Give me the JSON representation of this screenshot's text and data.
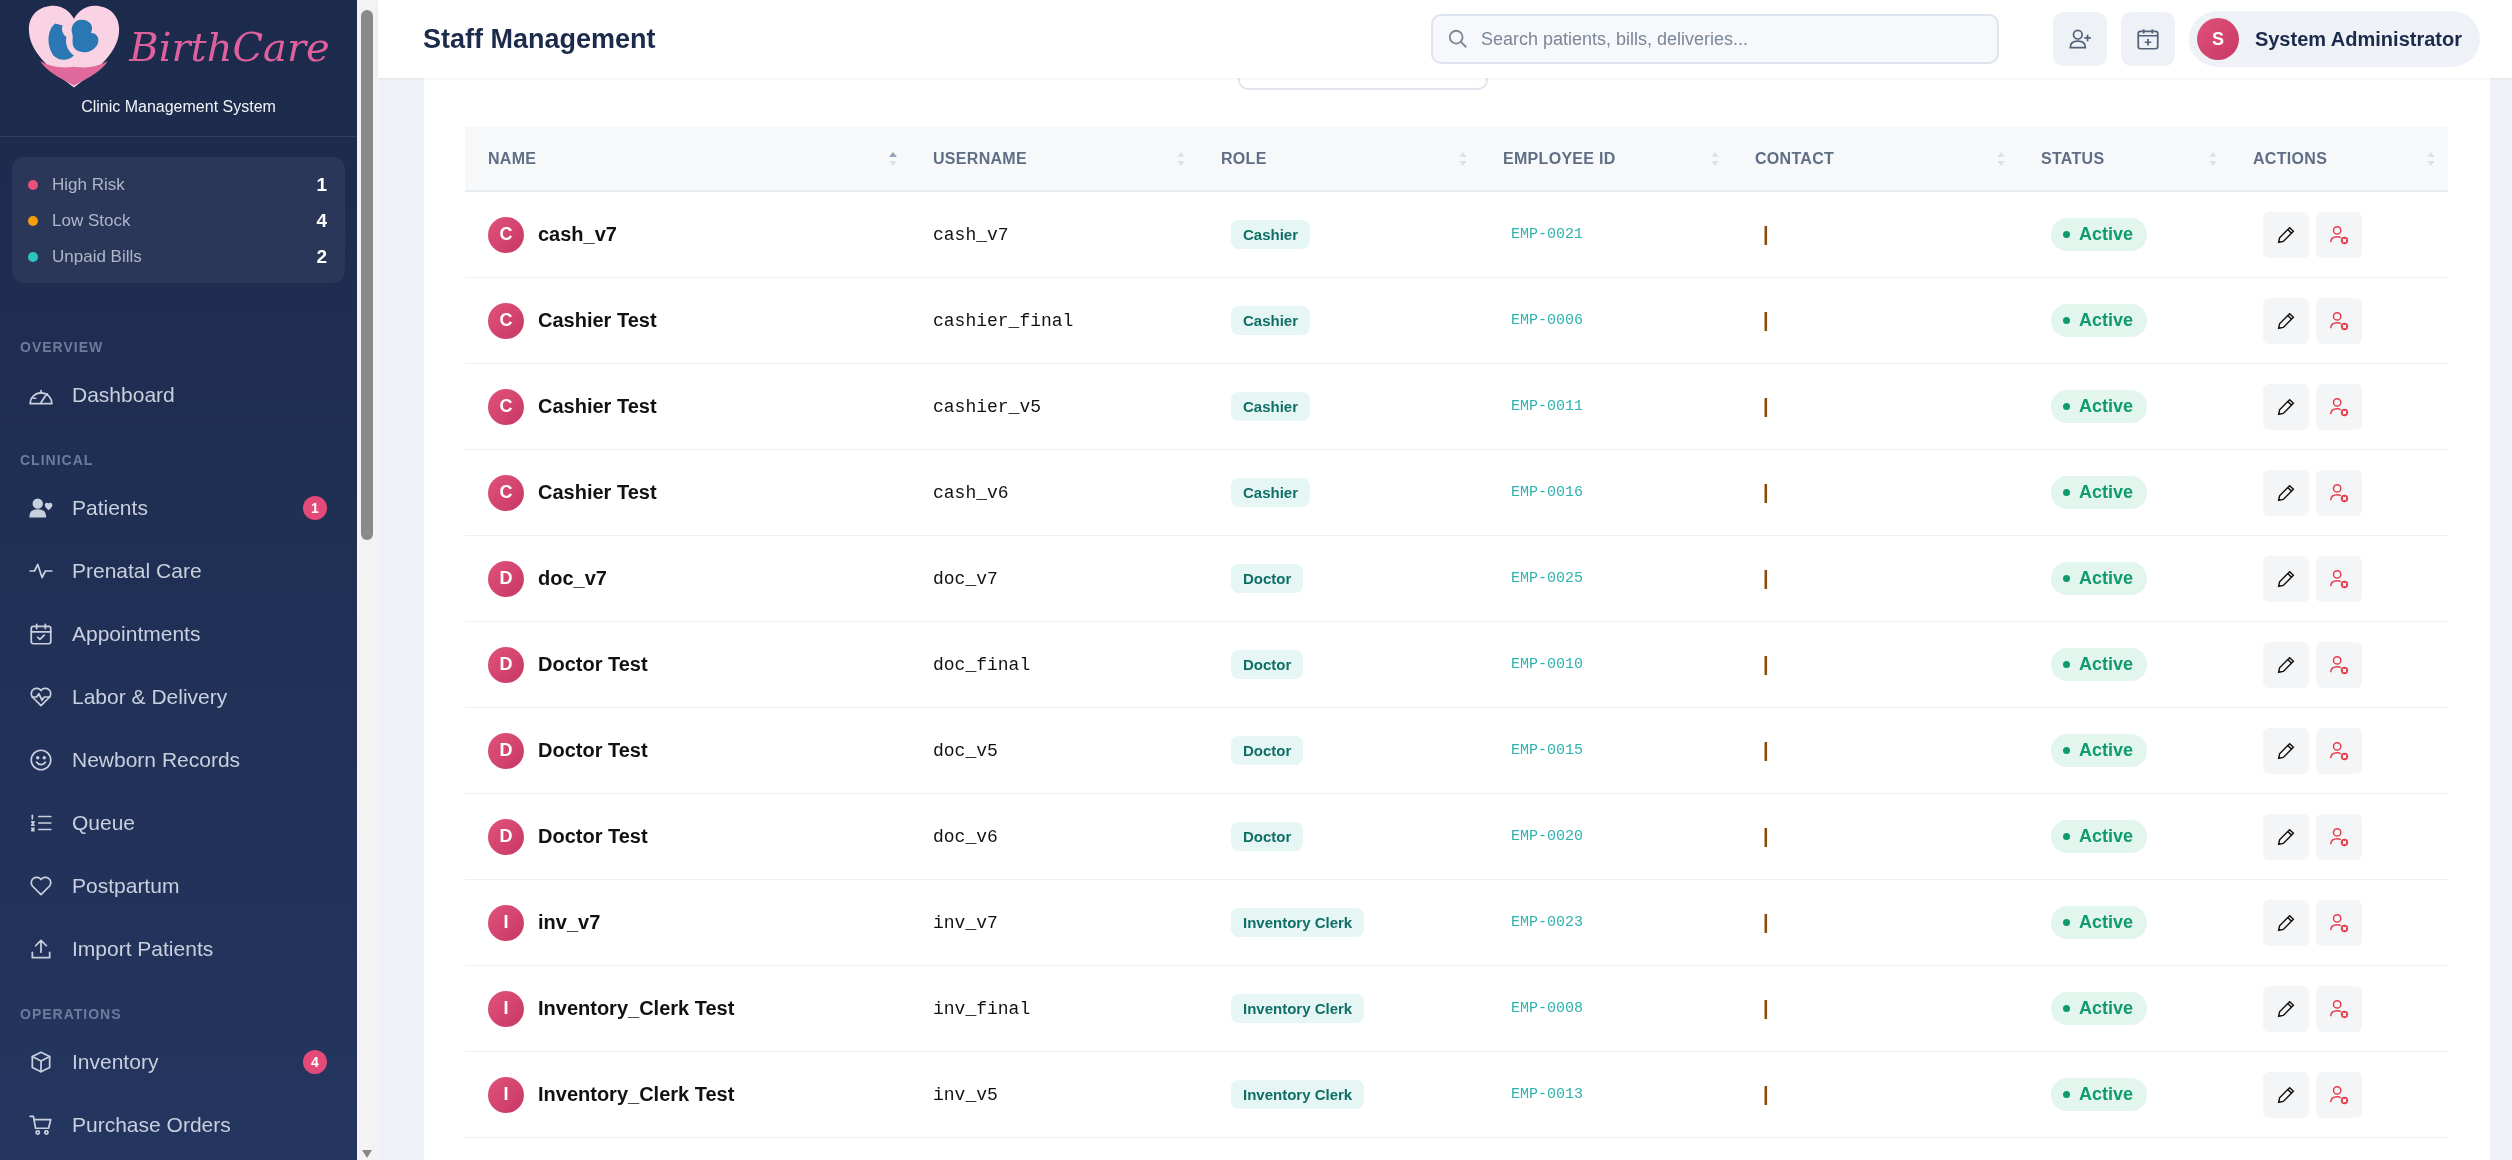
{
  "brand": {
    "name": "BirthCare",
    "subtitle": "Clinic Management System"
  },
  "alerts": [
    {
      "label": "High Risk",
      "count": "1",
      "color": "#e8527a"
    },
    {
      "label": "Low Stock",
      "count": "4",
      "color": "#f59e0b"
    },
    {
      "label": "Unpaid Bills",
      "count": "2",
      "color": "#2cc4bf"
    }
  ],
  "sidebar": {
    "sections": [
      {
        "label": "OVERVIEW",
        "items": [
          {
            "label": "Dashboard"
          }
        ]
      },
      {
        "label": "CLINICAL",
        "items": [
          {
            "label": "Patients",
            "badge": "1"
          },
          {
            "label": "Prenatal Care"
          },
          {
            "label": "Appointments"
          },
          {
            "label": "Labor & Delivery"
          },
          {
            "label": "Newborn Records"
          },
          {
            "label": "Queue"
          },
          {
            "label": "Postpartum"
          },
          {
            "label": "Import Patients"
          }
        ]
      },
      {
        "label": "OPERATIONS",
        "items": [
          {
            "label": "Inventory",
            "badge": "4"
          },
          {
            "label": "Purchase Orders"
          }
        ]
      }
    ]
  },
  "header": {
    "title": "Staff Management",
    "search": {
      "placeholder": "Search patients, bills, deliveries..."
    },
    "user": {
      "initial": "S",
      "name": "System Administrator"
    }
  },
  "table": {
    "columns": [
      {
        "label": "NAME",
        "sorted": true
      },
      {
        "label": "USERNAME",
        "sorted": false
      },
      {
        "label": "ROLE",
        "sorted": false
      },
      {
        "label": "EMPLOYEE ID",
        "sorted": false
      },
      {
        "label": "CONTACT",
        "sorted": false
      },
      {
        "label": "STATUS",
        "sorted": false
      },
      {
        "label": "ACTIONS",
        "sorted": false
      }
    ],
    "rows": [
      {
        "initial": "C",
        "name": "cash_v7",
        "username": "cash_v7",
        "role": "Cashier",
        "employee_id": "EMP-0021",
        "contact": "|",
        "status": "Active"
      },
      {
        "initial": "C",
        "name": "Cashier Test",
        "username": "cashier_final",
        "role": "Cashier",
        "employee_id": "EMP-0006",
        "contact": "|",
        "status": "Active"
      },
      {
        "initial": "C",
        "name": "Cashier Test",
        "username": "cashier_v5",
        "role": "Cashier",
        "employee_id": "EMP-0011",
        "contact": "|",
        "status": "Active"
      },
      {
        "initial": "C",
        "name": "Cashier Test",
        "username": "cash_v6",
        "role": "Cashier",
        "employee_id": "EMP-0016",
        "contact": "|",
        "status": "Active"
      },
      {
        "initial": "D",
        "name": "doc_v7",
        "username": "doc_v7",
        "role": "Doctor",
        "employee_id": "EMP-0025",
        "contact": "|",
        "status": "Active"
      },
      {
        "initial": "D",
        "name": "Doctor Test",
        "username": "doc_final",
        "role": "Doctor",
        "employee_id": "EMP-0010",
        "contact": "|",
        "status": "Active"
      },
      {
        "initial": "D",
        "name": "Doctor Test",
        "username": "doc_v5",
        "role": "Doctor",
        "employee_id": "EMP-0015",
        "contact": "|",
        "status": "Active"
      },
      {
        "initial": "D",
        "name": "Doctor Test",
        "username": "doc_v6",
        "role": "Doctor",
        "employee_id": "EMP-0020",
        "contact": "|",
        "status": "Active"
      },
      {
        "initial": "I",
        "name": "inv_v7",
        "username": "inv_v7",
        "role": "Inventory Clerk",
        "employee_id": "EMP-0023",
        "contact": "|",
        "status": "Active"
      },
      {
        "initial": "I",
        "name": "Inventory_Clerk Test",
        "username": "inv_final",
        "role": "Inventory Clerk",
        "employee_id": "EMP-0008",
        "contact": "|",
        "status": "Active"
      },
      {
        "initial": "I",
        "name": "Inventory_Clerk Test",
        "username": "inv_v5",
        "role": "Inventory Clerk",
        "employee_id": "EMP-0013",
        "contact": "|",
        "status": "Active"
      }
    ]
  }
}
